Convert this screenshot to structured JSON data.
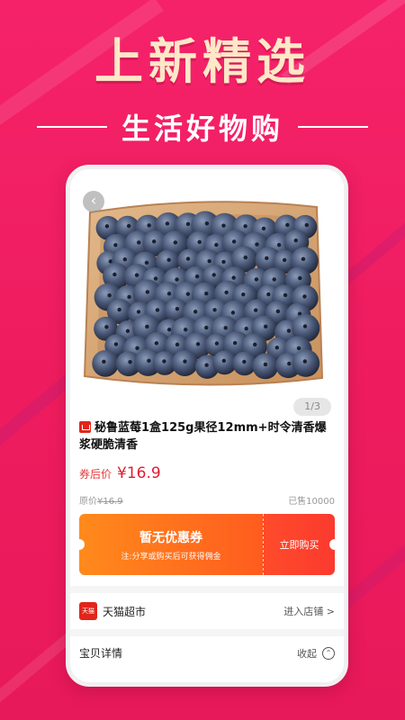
{
  "hero": {
    "title": "上新精选",
    "subtitle": "生活好物购"
  },
  "product": {
    "back_icon": "chevron-left-icon",
    "image_counter": "1/3",
    "title": "秘鲁蓝莓1盒125g果径12mm+时令清香爆浆硬脆清香",
    "coupon_price_label": "券后价",
    "coupon_price": "¥16.9",
    "original_price_label": "原价",
    "original_price": "¥16.9",
    "sold_count": "已售10000"
  },
  "coupon": {
    "main_text": "暂无优惠券",
    "note": "注:分享或购买后可获得佣金",
    "buy_label": "立即购买"
  },
  "shop": {
    "logo_text": "天猫",
    "name": "天猫超市",
    "enter_label": "进入店铺 >"
  },
  "details": {
    "label": "宝贝详情",
    "toggle_label": "收起"
  },
  "colors": {
    "background": "#ee1c5e",
    "hero_title": "#fde8c7",
    "price_red": "#e21b2f",
    "coupon_orange": "#ff7a1c"
  }
}
